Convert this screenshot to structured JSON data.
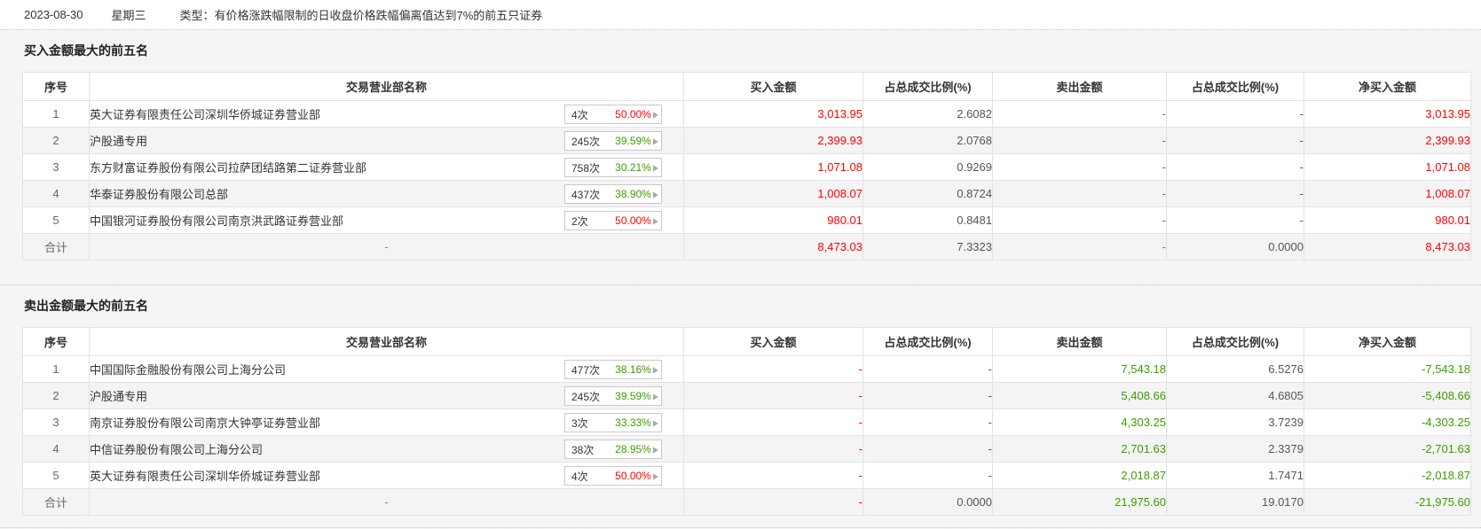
{
  "topbar": {
    "date": "2023-08-30",
    "weekday": "星期三",
    "type_text": "类型：有价格涨跌幅限制的日收盘价格跌幅偏离值达到7%的前五只证券"
  },
  "colors": {
    "up_red": "#ff0000",
    "down_green": "#3a9e00",
    "neutral": "#555555",
    "alt_row_bg": "#f4f4f4"
  },
  "buy_section": {
    "title": "买入金额最大的前五名",
    "columns": [
      "序号",
      "交易营业部名称",
      "买入金额",
      "占总成交比例(%)",
      "卖出金额",
      "占总成交比例(%)",
      "净买入金额"
    ],
    "rows": [
      {
        "no": "1",
        "name": "英大证券有限责任公司深圳华侨城证券营业部",
        "times": "4次",
        "pct": "50.00%",
        "pct_c": "red",
        "vals": [
          {
            "v": "3,013.95",
            "c": "red"
          },
          {
            "v": "2.6082",
            "c": "dark"
          },
          {
            "v": "-",
            "c": "green"
          },
          {
            "v": "-",
            "c": "dark"
          },
          {
            "v": "3,013.95",
            "c": "red"
          }
        ]
      },
      {
        "no": "2",
        "name": "沪股通专用",
        "times": "245次",
        "pct": "39.59%",
        "pct_c": "green",
        "vals": [
          {
            "v": "2,399.93",
            "c": "red"
          },
          {
            "v": "2.0768",
            "c": "dark"
          },
          {
            "v": "-",
            "c": "green"
          },
          {
            "v": "-",
            "c": "dark"
          },
          {
            "v": "2,399.93",
            "c": "red"
          }
        ]
      },
      {
        "no": "3",
        "name": "东方财富证券股份有限公司拉萨团结路第二证券营业部",
        "times": "758次",
        "pct": "30.21%",
        "pct_c": "green",
        "vals": [
          {
            "v": "1,071.08",
            "c": "red"
          },
          {
            "v": "0.9269",
            "c": "dark"
          },
          {
            "v": "-",
            "c": "green"
          },
          {
            "v": "-",
            "c": "dark"
          },
          {
            "v": "1,071.08",
            "c": "red"
          }
        ]
      },
      {
        "no": "4",
        "name": "华泰证券股份有限公司总部",
        "times": "437次",
        "pct": "38.90%",
        "pct_c": "green",
        "vals": [
          {
            "v": "1,008.07",
            "c": "red"
          },
          {
            "v": "0.8724",
            "c": "dark"
          },
          {
            "v": "-",
            "c": "green"
          },
          {
            "v": "-",
            "c": "dark"
          },
          {
            "v": "1,008.07",
            "c": "red"
          }
        ]
      },
      {
        "no": "5",
        "name": "中国银河证券股份有限公司南京洪武路证券营业部",
        "times": "2次",
        "pct": "50.00%",
        "pct_c": "red",
        "vals": [
          {
            "v": "980.01",
            "c": "red"
          },
          {
            "v": "0.8481",
            "c": "dark"
          },
          {
            "v": "-",
            "c": "green"
          },
          {
            "v": "-",
            "c": "dark"
          },
          {
            "v": "980.01",
            "c": "red"
          }
        ]
      }
    ],
    "total": {
      "label": "合计",
      "name": "-",
      "vals": [
        {
          "v": "8,473.03",
          "c": "red"
        },
        {
          "v": "7.3323",
          "c": "dark"
        },
        {
          "v": "-",
          "c": "green"
        },
        {
          "v": "0.0000",
          "c": "dark"
        },
        {
          "v": "8,473.03",
          "c": "red"
        }
      ]
    }
  },
  "sell_section": {
    "title": "卖出金额最大的前五名",
    "columns": [
      "序号",
      "交易营业部名称",
      "买入金额",
      "占总成交比例(%)",
      "卖出金额",
      "占总成交比例(%)",
      "净买入金额"
    ],
    "rows": [
      {
        "no": "1",
        "name": "中国国际金融股份有限公司上海分公司",
        "times": "477次",
        "pct": "38.16%",
        "pct_c": "green",
        "vals": [
          {
            "v": "-",
            "c": "red"
          },
          {
            "v": "-",
            "c": "dark"
          },
          {
            "v": "7,543.18",
            "c": "green"
          },
          {
            "v": "6.5276",
            "c": "dark"
          },
          {
            "v": "-7,543.18",
            "c": "green"
          }
        ]
      },
      {
        "no": "2",
        "name": "沪股通专用",
        "times": "245次",
        "pct": "39.59%",
        "pct_c": "green",
        "vals": [
          {
            "v": "-",
            "c": "red"
          },
          {
            "v": "-",
            "c": "dark"
          },
          {
            "v": "5,408.66",
            "c": "green"
          },
          {
            "v": "4.6805",
            "c": "dark"
          },
          {
            "v": "-5,408.66",
            "c": "green"
          }
        ]
      },
      {
        "no": "3",
        "name": "南京证券股份有限公司南京大钟亭证券营业部",
        "times": "3次",
        "pct": "33.33%",
        "pct_c": "green",
        "vals": [
          {
            "v": "-",
            "c": "red"
          },
          {
            "v": "-",
            "c": "dark"
          },
          {
            "v": "4,303.25",
            "c": "green"
          },
          {
            "v": "3.7239",
            "c": "dark"
          },
          {
            "v": "-4,303.25",
            "c": "green"
          }
        ]
      },
      {
        "no": "4",
        "name": "中信证券股份有限公司上海分公司",
        "times": "38次",
        "pct": "28.95%",
        "pct_c": "green",
        "vals": [
          {
            "v": "-",
            "c": "red"
          },
          {
            "v": "-",
            "c": "dark"
          },
          {
            "v": "2,701.63",
            "c": "green"
          },
          {
            "v": "2.3379",
            "c": "dark"
          },
          {
            "v": "-2,701.63",
            "c": "green"
          }
        ]
      },
      {
        "no": "5",
        "name": "英大证券有限责任公司深圳华侨城证券营业部",
        "times": "4次",
        "pct": "50.00%",
        "pct_c": "red",
        "vals": [
          {
            "v": "-",
            "c": "red"
          },
          {
            "v": "-",
            "c": "dark"
          },
          {
            "v": "2,018.87",
            "c": "green"
          },
          {
            "v": "1.7471",
            "c": "dark"
          },
          {
            "v": "-2,018.87",
            "c": "green"
          }
        ]
      }
    ],
    "total": {
      "label": "合计",
      "name": "-",
      "vals": [
        {
          "v": "-",
          "c": "red"
        },
        {
          "v": "0.0000",
          "c": "dark"
        },
        {
          "v": "21,975.60",
          "c": "green"
        },
        {
          "v": "19.0170",
          "c": "dark"
        },
        {
          "v": "-21,975.60",
          "c": "green"
        }
      ]
    }
  },
  "badge": {
    "arrow_icon": "▶"
  }
}
